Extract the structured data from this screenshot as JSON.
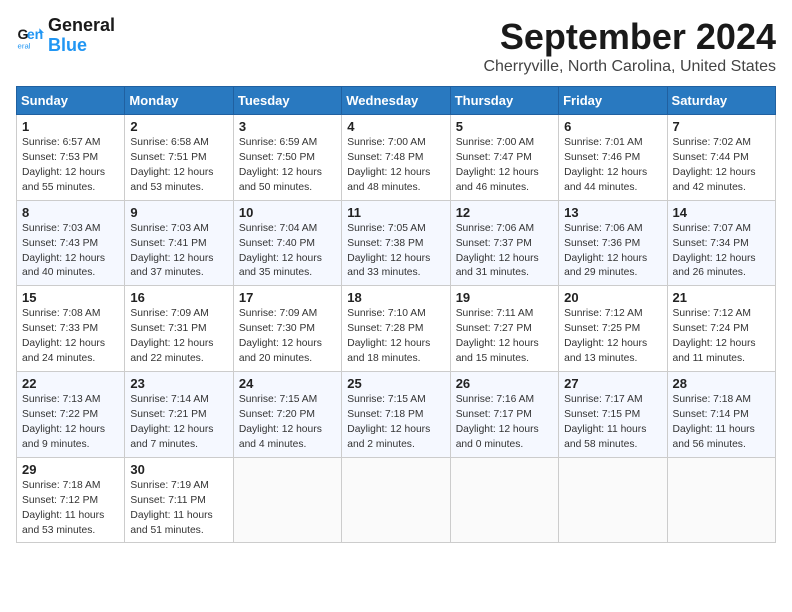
{
  "logo": {
    "line1": "General",
    "line2": "Blue"
  },
  "title": "September 2024",
  "subtitle": "Cherryville, North Carolina, United States",
  "days_of_week": [
    "Sunday",
    "Monday",
    "Tuesday",
    "Wednesday",
    "Thursday",
    "Friday",
    "Saturday"
  ],
  "weeks": [
    [
      {
        "day": "1",
        "info": "Sunrise: 6:57 AM\nSunset: 7:53 PM\nDaylight: 12 hours\nand 55 minutes."
      },
      {
        "day": "2",
        "info": "Sunrise: 6:58 AM\nSunset: 7:51 PM\nDaylight: 12 hours\nand 53 minutes."
      },
      {
        "day": "3",
        "info": "Sunrise: 6:59 AM\nSunset: 7:50 PM\nDaylight: 12 hours\nand 50 minutes."
      },
      {
        "day": "4",
        "info": "Sunrise: 7:00 AM\nSunset: 7:48 PM\nDaylight: 12 hours\nand 48 minutes."
      },
      {
        "day": "5",
        "info": "Sunrise: 7:00 AM\nSunset: 7:47 PM\nDaylight: 12 hours\nand 46 minutes."
      },
      {
        "day": "6",
        "info": "Sunrise: 7:01 AM\nSunset: 7:46 PM\nDaylight: 12 hours\nand 44 minutes."
      },
      {
        "day": "7",
        "info": "Sunrise: 7:02 AM\nSunset: 7:44 PM\nDaylight: 12 hours\nand 42 minutes."
      }
    ],
    [
      {
        "day": "8",
        "info": "Sunrise: 7:03 AM\nSunset: 7:43 PM\nDaylight: 12 hours\nand 40 minutes."
      },
      {
        "day": "9",
        "info": "Sunrise: 7:03 AM\nSunset: 7:41 PM\nDaylight: 12 hours\nand 37 minutes."
      },
      {
        "day": "10",
        "info": "Sunrise: 7:04 AM\nSunset: 7:40 PM\nDaylight: 12 hours\nand 35 minutes."
      },
      {
        "day": "11",
        "info": "Sunrise: 7:05 AM\nSunset: 7:38 PM\nDaylight: 12 hours\nand 33 minutes."
      },
      {
        "day": "12",
        "info": "Sunrise: 7:06 AM\nSunset: 7:37 PM\nDaylight: 12 hours\nand 31 minutes."
      },
      {
        "day": "13",
        "info": "Sunrise: 7:06 AM\nSunset: 7:36 PM\nDaylight: 12 hours\nand 29 minutes."
      },
      {
        "day": "14",
        "info": "Sunrise: 7:07 AM\nSunset: 7:34 PM\nDaylight: 12 hours\nand 26 minutes."
      }
    ],
    [
      {
        "day": "15",
        "info": "Sunrise: 7:08 AM\nSunset: 7:33 PM\nDaylight: 12 hours\nand 24 minutes."
      },
      {
        "day": "16",
        "info": "Sunrise: 7:09 AM\nSunset: 7:31 PM\nDaylight: 12 hours\nand 22 minutes."
      },
      {
        "day": "17",
        "info": "Sunrise: 7:09 AM\nSunset: 7:30 PM\nDaylight: 12 hours\nand 20 minutes."
      },
      {
        "day": "18",
        "info": "Sunrise: 7:10 AM\nSunset: 7:28 PM\nDaylight: 12 hours\nand 18 minutes."
      },
      {
        "day": "19",
        "info": "Sunrise: 7:11 AM\nSunset: 7:27 PM\nDaylight: 12 hours\nand 15 minutes."
      },
      {
        "day": "20",
        "info": "Sunrise: 7:12 AM\nSunset: 7:25 PM\nDaylight: 12 hours\nand 13 minutes."
      },
      {
        "day": "21",
        "info": "Sunrise: 7:12 AM\nSunset: 7:24 PM\nDaylight: 12 hours\nand 11 minutes."
      }
    ],
    [
      {
        "day": "22",
        "info": "Sunrise: 7:13 AM\nSunset: 7:22 PM\nDaylight: 12 hours\nand 9 minutes."
      },
      {
        "day": "23",
        "info": "Sunrise: 7:14 AM\nSunset: 7:21 PM\nDaylight: 12 hours\nand 7 minutes."
      },
      {
        "day": "24",
        "info": "Sunrise: 7:15 AM\nSunset: 7:20 PM\nDaylight: 12 hours\nand 4 minutes."
      },
      {
        "day": "25",
        "info": "Sunrise: 7:15 AM\nSunset: 7:18 PM\nDaylight: 12 hours\nand 2 minutes."
      },
      {
        "day": "26",
        "info": "Sunrise: 7:16 AM\nSunset: 7:17 PM\nDaylight: 12 hours\nand 0 minutes."
      },
      {
        "day": "27",
        "info": "Sunrise: 7:17 AM\nSunset: 7:15 PM\nDaylight: 11 hours\nand 58 minutes."
      },
      {
        "day": "28",
        "info": "Sunrise: 7:18 AM\nSunset: 7:14 PM\nDaylight: 11 hours\nand 56 minutes."
      }
    ],
    [
      {
        "day": "29",
        "info": "Sunrise: 7:18 AM\nSunset: 7:12 PM\nDaylight: 11 hours\nand 53 minutes."
      },
      {
        "day": "30",
        "info": "Sunrise: 7:19 AM\nSunset: 7:11 PM\nDaylight: 11 hours\nand 51 minutes."
      },
      {
        "day": "",
        "info": ""
      },
      {
        "day": "",
        "info": ""
      },
      {
        "day": "",
        "info": ""
      },
      {
        "day": "",
        "info": ""
      },
      {
        "day": "",
        "info": ""
      }
    ]
  ]
}
